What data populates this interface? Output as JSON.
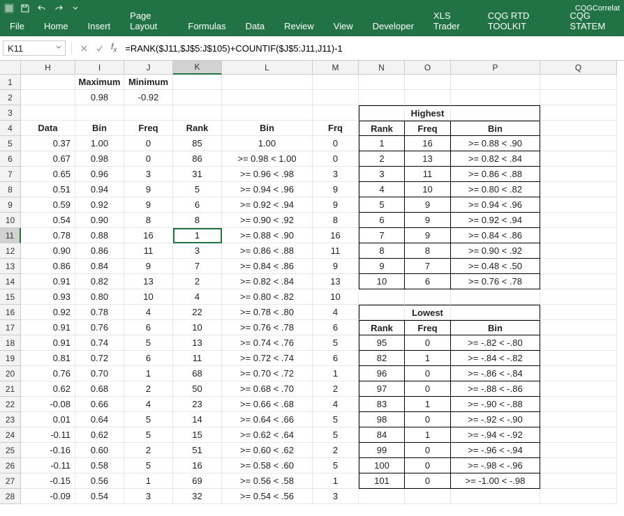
{
  "titlebar": {
    "filename": "CQGCorrelat"
  },
  "ribbon": {
    "tabs": [
      "File",
      "Home",
      "Insert",
      "Page Layout",
      "Formulas",
      "Data",
      "Review",
      "View",
      "Developer",
      "XLS Trader",
      "CQG RTD TOOLKIT",
      "CQG STATEM"
    ]
  },
  "formula_bar": {
    "name_box": "K11",
    "formula": "=RANK($J11,$J$5:J$105)+COUNTIF($J$5:J11,J11)-1"
  },
  "columns": [
    {
      "letter": "",
      "w": 30
    },
    {
      "letter": "H",
      "w": 78
    },
    {
      "letter": "I",
      "w": 70
    },
    {
      "letter": "J",
      "w": 70
    },
    {
      "letter": "K",
      "w": 70
    },
    {
      "letter": "L",
      "w": 130
    },
    {
      "letter": "M",
      "w": 66
    },
    {
      "letter": "N",
      "w": 66
    },
    {
      "letter": "O",
      "w": 66
    },
    {
      "letter": "P",
      "w": 128
    },
    {
      "letter": "Q",
      "w": 110
    }
  ],
  "active_col": "K",
  "active_row": 11,
  "headers": {
    "maximum": "Maximum",
    "minimum": "Minimum",
    "data": "Data",
    "bin": "Bin",
    "freq": "Freq",
    "rank": "Rank",
    "bin2": "Bin",
    "frq": "Frq",
    "highest": "Highest",
    "lowest": "Lowest",
    "rank2": "Rank",
    "freq2": "Freq",
    "bin3": "Bin"
  },
  "maxmin": {
    "max": "0.98",
    "min": "-0.92"
  },
  "main_rows": [
    {
      "n": 5,
      "data": "0.37",
      "bin": "1.00",
      "freq": "0",
      "rank": "85",
      "bin2": "1.00",
      "frq": "0"
    },
    {
      "n": 6,
      "data": "0.67",
      "bin": "0.98",
      "freq": "0",
      "rank": "86",
      "bin2": ">= 0.98 < 1.00",
      "frq": "0"
    },
    {
      "n": 7,
      "data": "0.65",
      "bin": "0.96",
      "freq": "3",
      "rank": "31",
      "bin2": ">= 0.96 < .98",
      "frq": "3"
    },
    {
      "n": 8,
      "data": "0.51",
      "bin": "0.94",
      "freq": "9",
      "rank": "5",
      "bin2": ">= 0.94 < .96",
      "frq": "9"
    },
    {
      "n": 9,
      "data": "0.59",
      "bin": "0.92",
      "freq": "9",
      "rank": "6",
      "bin2": ">= 0.92 < .94",
      "frq": "9"
    },
    {
      "n": 10,
      "data": "0.54",
      "bin": "0.90",
      "freq": "8",
      "rank": "8",
      "bin2": ">= 0.90 < .92",
      "frq": "8"
    },
    {
      "n": 11,
      "data": "0.78",
      "bin": "0.88",
      "freq": "16",
      "rank": "1",
      "bin2": ">= 0.88 < .90",
      "frq": "16"
    },
    {
      "n": 12,
      "data": "0.90",
      "bin": "0.86",
      "freq": "11",
      "rank": "3",
      "bin2": ">= 0.86 < .88",
      "frq": "11"
    },
    {
      "n": 13,
      "data": "0.86",
      "bin": "0.84",
      "freq": "9",
      "rank": "7",
      "bin2": ">= 0.84 < .86",
      "frq": "9"
    },
    {
      "n": 14,
      "data": "0.91",
      "bin": "0.82",
      "freq": "13",
      "rank": "2",
      "bin2": ">= 0.82 < .84",
      "frq": "13"
    },
    {
      "n": 15,
      "data": "0.93",
      "bin": "0.80",
      "freq": "10",
      "rank": "4",
      "bin2": ">= 0.80 < .82",
      "frq": "10"
    },
    {
      "n": 16,
      "data": "0.92",
      "bin": "0.78",
      "freq": "4",
      "rank": "22",
      "bin2": ">= 0.78 < .80",
      "frq": "4"
    },
    {
      "n": 17,
      "data": "0.91",
      "bin": "0.76",
      "freq": "6",
      "rank": "10",
      "bin2": ">= 0.76 < .78",
      "frq": "6"
    },
    {
      "n": 18,
      "data": "0.91",
      "bin": "0.74",
      "freq": "5",
      "rank": "13",
      "bin2": ">= 0.74 < .76",
      "frq": "5"
    },
    {
      "n": 19,
      "data": "0.81",
      "bin": "0.72",
      "freq": "6",
      "rank": "11",
      "bin2": ">= 0.72 < .74",
      "frq": "6"
    },
    {
      "n": 20,
      "data": "0.76",
      "bin": "0.70",
      "freq": "1",
      "rank": "68",
      "bin2": ">= 0.70 < .72",
      "frq": "1"
    },
    {
      "n": 21,
      "data": "0.62",
      "bin": "0.68",
      "freq": "2",
      "rank": "50",
      "bin2": ">= 0.68 < .70",
      "frq": "2"
    },
    {
      "n": 22,
      "data": "-0.08",
      "bin": "0.66",
      "freq": "4",
      "rank": "23",
      "bin2": ">= 0.66 < .68",
      "frq": "4"
    },
    {
      "n": 23,
      "data": "0.01",
      "bin": "0.64",
      "freq": "5",
      "rank": "14",
      "bin2": ">= 0.64 < .66",
      "frq": "5"
    },
    {
      "n": 24,
      "data": "-0.11",
      "bin": "0.62",
      "freq": "5",
      "rank": "15",
      "bin2": ">= 0.62 < .64",
      "frq": "5"
    },
    {
      "n": 25,
      "data": "-0.16",
      "bin": "0.60",
      "freq": "2",
      "rank": "51",
      "bin2": ">= 0.60 < .62",
      "frq": "2"
    },
    {
      "n": 26,
      "data": "-0.11",
      "bin": "0.58",
      "freq": "5",
      "rank": "16",
      "bin2": ">= 0.58 < .60",
      "frq": "5"
    },
    {
      "n": 27,
      "data": "-0.15",
      "bin": "0.56",
      "freq": "1",
      "rank": "69",
      "bin2": ">= 0.56 < .58",
      "frq": "1"
    },
    {
      "n": 28,
      "data": "-0.09",
      "bin": "0.54",
      "freq": "3",
      "rank": "32",
      "bin2": ">= 0.54 < .56",
      "frq": "3"
    }
  ],
  "highest": [
    {
      "rank": "1",
      "freq": "16",
      "bin": ">= 0.88 < .90"
    },
    {
      "rank": "2",
      "freq": "13",
      "bin": ">= 0.82 < .84"
    },
    {
      "rank": "3",
      "freq": "11",
      "bin": ">= 0.86 < .88"
    },
    {
      "rank": "4",
      "freq": "10",
      "bin": ">= 0.80 < .82"
    },
    {
      "rank": "5",
      "freq": "9",
      "bin": ">= 0.94 < .96"
    },
    {
      "rank": "6",
      "freq": "9",
      "bin": ">= 0.92 < .94"
    },
    {
      "rank": "7",
      "freq": "9",
      "bin": ">= 0.84 < .86"
    },
    {
      "rank": "8",
      "freq": "8",
      "bin": ">= 0.90 < .92"
    },
    {
      "rank": "9",
      "freq": "7",
      "bin": ">= 0.48 < .50"
    },
    {
      "rank": "10",
      "freq": "6",
      "bin": ">= 0.76 < .78"
    }
  ],
  "lowest": [
    {
      "rank": "95",
      "freq": "0",
      "bin": ">= -.82 < -.80"
    },
    {
      "rank": "82",
      "freq": "1",
      "bin": ">= -.84 < -.82"
    },
    {
      "rank": "96",
      "freq": "0",
      "bin": ">= -.86 < -.84"
    },
    {
      "rank": "97",
      "freq": "0",
      "bin": ">= -.88 < -.86"
    },
    {
      "rank": "83",
      "freq": "1",
      "bin": ">= -.90 < -.88"
    },
    {
      "rank": "98",
      "freq": "0",
      "bin": ">= -.92 < -.90"
    },
    {
      "rank": "84",
      "freq": "1",
      "bin": ">= -.94 < -.92"
    },
    {
      "rank": "99",
      "freq": "0",
      "bin": ">= -.96 < -.94"
    },
    {
      "rank": "100",
      "freq": "0",
      "bin": ">= -.98 < -.96"
    },
    {
      "rank": "101",
      "freq": "0",
      "bin": ">= -1.00 < -.98"
    }
  ]
}
